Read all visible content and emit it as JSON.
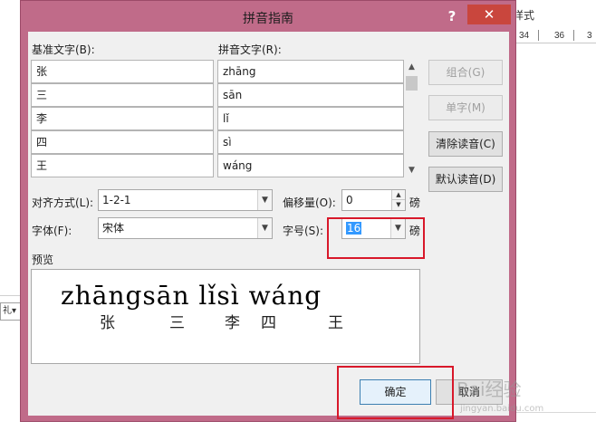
{
  "dialog": {
    "title": "拼音指南",
    "help": "?",
    "close": "✕"
  },
  "background": {
    "style_label": "样式",
    "ruler": [
      "34",
      "36",
      "3"
    ],
    "left_widget": "礼▾"
  },
  "labels": {
    "base_text": "基准文字(B):",
    "pinyin_text": "拼音文字(R):",
    "alignment": "对齐方式(L):",
    "offset": "偏移量(O):",
    "font": "字体(F):",
    "size": "字号(S):",
    "preview": "预览",
    "unit_offset": "磅",
    "unit_size": "磅"
  },
  "rows": [
    {
      "base": "张",
      "pinyin": "zhāng"
    },
    {
      "base": "三",
      "pinyin": "sān"
    },
    {
      "base": "李",
      "pinyin": "lǐ"
    },
    {
      "base": "四",
      "pinyin": "sì"
    },
    {
      "base": "王",
      "pinyin": "wáng"
    }
  ],
  "buttons": {
    "combine": "组合(G)",
    "single": "单字(M)",
    "clear": "清除读音(C)",
    "default_reading": "默认读音(D)",
    "ok": "确定",
    "cancel": "取消"
  },
  "fields": {
    "alignment": "1-2-1",
    "offset": "0",
    "font": "宋体",
    "size": "16"
  },
  "preview": {
    "pinyin": "zhāngsān lǐsì wáng",
    "hanzi": [
      "张",
      "三",
      "李",
      "四",
      "王"
    ]
  },
  "watermark": {
    "text": "Bai经验",
    "sub": "jingyan.baidu.com"
  },
  "colors": {
    "title_bar": "#c06b89",
    "close_button": "#c9463d",
    "highlight_box": "#d8182a",
    "selection": "#3399ff"
  }
}
